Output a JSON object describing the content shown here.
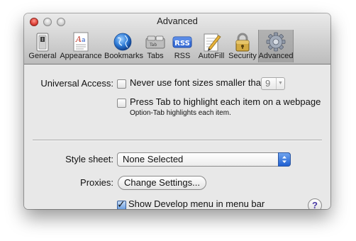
{
  "window": {
    "title": "Advanced"
  },
  "toolbar": {
    "items": [
      {
        "label": "General",
        "icon": "general-switch-icon",
        "selected": false
      },
      {
        "label": "Appearance",
        "icon": "appearance-font-icon",
        "selected": false
      },
      {
        "label": "Bookmarks",
        "icon": "bookmarks-globe-icon",
        "selected": false
      },
      {
        "label": "Tabs",
        "icon": "tabs-icon",
        "selected": false
      },
      {
        "label": "RSS",
        "icon": "rss-icon",
        "badge": "RSS",
        "selected": false
      },
      {
        "label": "AutoFill",
        "icon": "autofill-pen-icon",
        "selected": false
      },
      {
        "label": "Security",
        "icon": "security-lock-icon",
        "selected": false
      },
      {
        "label": "Advanced",
        "icon": "advanced-gear-icon",
        "selected": true
      }
    ]
  },
  "universal_access": {
    "label": "Universal Access:",
    "never_font_size": {
      "label": "Never use font sizes smaller than",
      "checked": false,
      "value": "9"
    },
    "press_tab": {
      "label": "Press Tab to highlight each item on a webpage",
      "checked": false,
      "hint": "Option-Tab highlights each item."
    }
  },
  "style_sheet": {
    "label": "Style sheet:",
    "value": "None Selected"
  },
  "proxies": {
    "label": "Proxies:",
    "button_label": "Change Settings..."
  },
  "develop_menu": {
    "label": "Show Develop menu in menu bar",
    "checked": true
  },
  "help": {
    "label": "?"
  },
  "colors": {
    "window_bg": "#e8e8e8",
    "close_red": "#e0443b",
    "popup_blue": "#1f5fd1",
    "rss_badge": "#3a6fd8"
  }
}
